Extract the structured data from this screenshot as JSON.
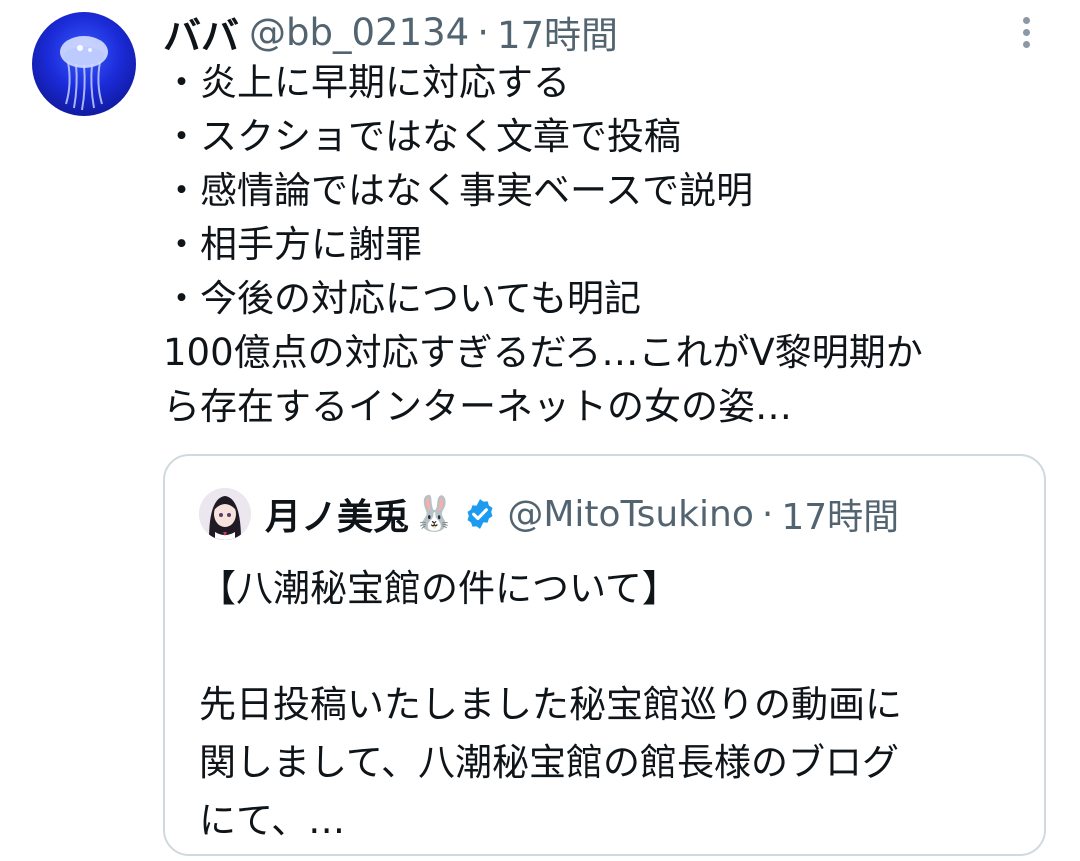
{
  "tweet": {
    "display_name": "ババ",
    "handle": "@bb_02134",
    "separator": "·",
    "time": "17時間",
    "avatar_icon": "jellyfish-avatar",
    "more_icon": "more-options-icon",
    "body_lines": [
      "・炎上に早期に対応する",
      "・スクショではなく文章で投稿",
      "・感情論ではなく事実ベースで説明",
      "・相手方に謝罪",
      "・今後の対応についても明記",
      "100億点の対応すぎるだろ…これがV黎明期か",
      "ら存在するインターネットの女の姿…"
    ]
  },
  "quote": {
    "display_name": "月ノ美兎",
    "emoji": "🐰",
    "verified_icon": "verified-badge-icon",
    "handle": "@MitoTsukino",
    "separator": "·",
    "time": "17時間",
    "heading": "【八潮秘宝館の件について】",
    "body_lines": [
      "先日投稿いたしました秘宝館巡りの動画に",
      "関しまして、八潮秘宝館の館長様のブログ",
      "にて、…"
    ]
  },
  "colors": {
    "text_primary": "#0f1419",
    "text_secondary": "#536471",
    "border": "#cfd9de",
    "verified": "#1d9bf0",
    "more_dots": "#8b98a5"
  }
}
